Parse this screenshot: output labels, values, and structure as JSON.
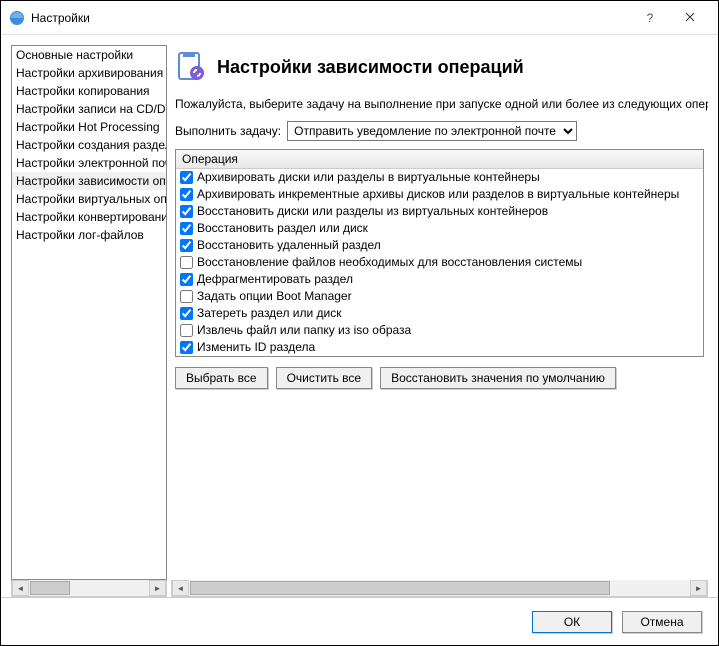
{
  "window": {
    "title": "Настройки"
  },
  "sidebar": {
    "items": [
      "Основные настройки",
      "Настройки архивирования",
      "Настройки копирования",
      "Настройки записи на CD/DVD",
      "Настройки Hot Processing",
      "Настройки создания разделов",
      "Настройки электронной почты",
      "Настройки зависимости операций",
      "Настройки виртуальных операций",
      "Настройки конвертирования",
      "Настройки лог-файлов"
    ],
    "selected_index": 7
  },
  "main": {
    "title": "Настройки зависимости операций",
    "description": "Пожалуйста, выберите задачу на выполнение при запуске одной или более из следующих операций",
    "task_label": "Выполнить задачу:",
    "task_selected": "Отправить уведомление по электронной почте",
    "oplist_header": "Операция",
    "operations": [
      {
        "label": "Архивировать диски или разделы в виртуальные контейнеры",
        "checked": true
      },
      {
        "label": "Архивировать инкрементные архивы дисков или разделов в виртуальные контейнеры",
        "checked": true
      },
      {
        "label": "Восстановить диски или разделы из виртуальных контейнеров",
        "checked": true
      },
      {
        "label": "Восстановить раздел или диск",
        "checked": true
      },
      {
        "label": "Восстановить удаленный раздел",
        "checked": true
      },
      {
        "label": "Восстановление файлов необходимых для восстановления системы",
        "checked": false
      },
      {
        "label": "Дефрагментировать раздел",
        "checked": true
      },
      {
        "label": "Задать опции Boot Manager",
        "checked": false
      },
      {
        "label": "Затереть раздел или диск",
        "checked": true
      },
      {
        "label": "Извлечь файл или папку из iso образа",
        "checked": false
      },
      {
        "label": "Изменить ID раздела",
        "checked": true
      }
    ],
    "buttons": {
      "select_all": "Выбрать все",
      "clear_all": "Очистить все",
      "restore_defaults": "Восстановить значения по умолчанию"
    }
  },
  "footer": {
    "ok": "ОК",
    "cancel": "Отмена"
  }
}
